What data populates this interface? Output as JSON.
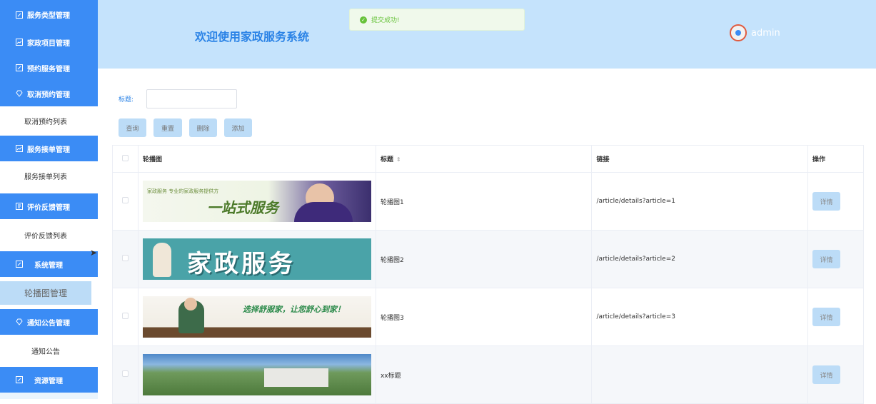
{
  "sidebar": {
    "groups": [
      {
        "label": "服务类型管理",
        "icon": "edit-icon"
      },
      {
        "label": "家政项目管理",
        "icon": "chart-icon"
      },
      {
        "label": "预约服务管理",
        "icon": "edit-icon"
      },
      {
        "label": "取消预约管理",
        "icon": "gem-icon",
        "sub": "取消预约列表"
      },
      {
        "label": "服务接单管理",
        "icon": "chart-icon",
        "sub": "服务接单列表"
      },
      {
        "label": "评价反馈管理",
        "icon": "doc-icon",
        "sub": "评价反馈列表"
      },
      {
        "label": "系统管理",
        "icon": "edit-icon",
        "sub": "轮播图管理"
      },
      {
        "label": "通知公告管理",
        "icon": "gem-icon",
        "sub": "通知公告"
      },
      {
        "label": "资源管理",
        "icon": "edit-icon"
      }
    ]
  },
  "header": {
    "title": "欢迎使用家政服务系统",
    "user": "admin"
  },
  "toast": {
    "message": "提交成功!"
  },
  "search": {
    "label": "标题:",
    "value": ""
  },
  "buttons": {
    "query": "查询",
    "reset": "重置",
    "delete": "删除",
    "add": "添加"
  },
  "table": {
    "headers": {
      "image": "轮播图",
      "title": "标题",
      "link": "链接",
      "action": "操作"
    },
    "rows": [
      {
        "title": "轮播图1",
        "link": "/article/details?article=1",
        "action": "详情",
        "banner_text": "一站式服务",
        "banner_small": "家政服务 专业的家政服务提供方"
      },
      {
        "title": "轮播图2",
        "link": "/article/details?article=2",
        "action": "详情",
        "banner_text": "家政服务"
      },
      {
        "title": "轮播图3",
        "link": "/article/details?article=3",
        "action": "详情",
        "banner_text": "选择舒服家，让您舒心到家！"
      },
      {
        "title": "xx标题",
        "link": "",
        "action": "详情"
      }
    ]
  }
}
